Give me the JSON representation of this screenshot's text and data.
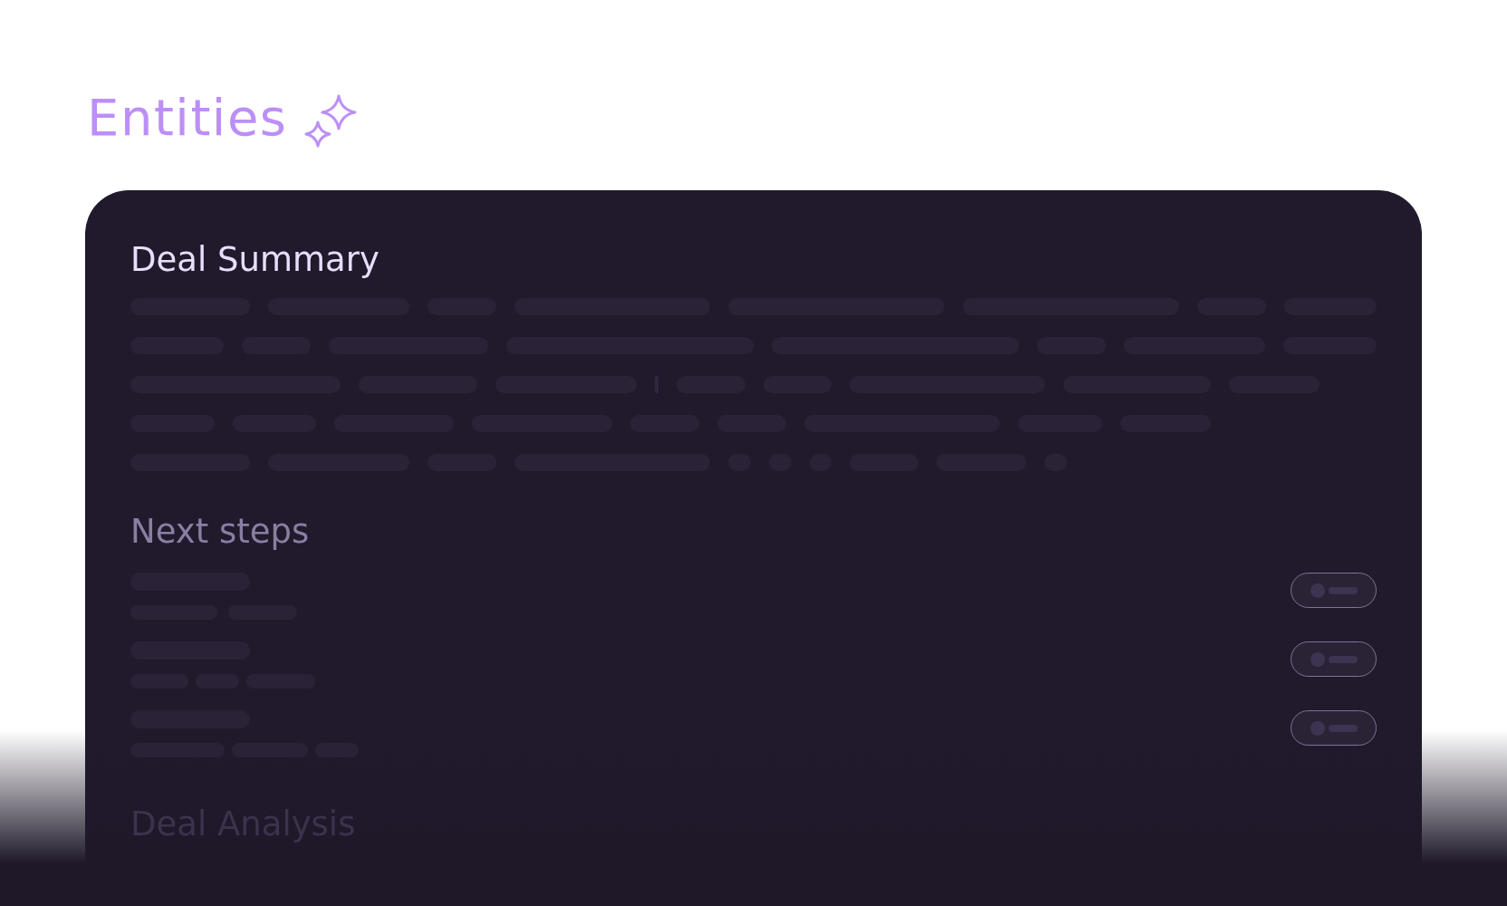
{
  "page": {
    "title": "Entities"
  },
  "card": {
    "sections": [
      {
        "kind": "paragraph",
        "heading": "Deal Summary"
      },
      {
        "kind": "list",
        "heading": "Next steps"
      },
      {
        "kind": "faded",
        "heading": "Deal Analysis"
      }
    ]
  }
}
